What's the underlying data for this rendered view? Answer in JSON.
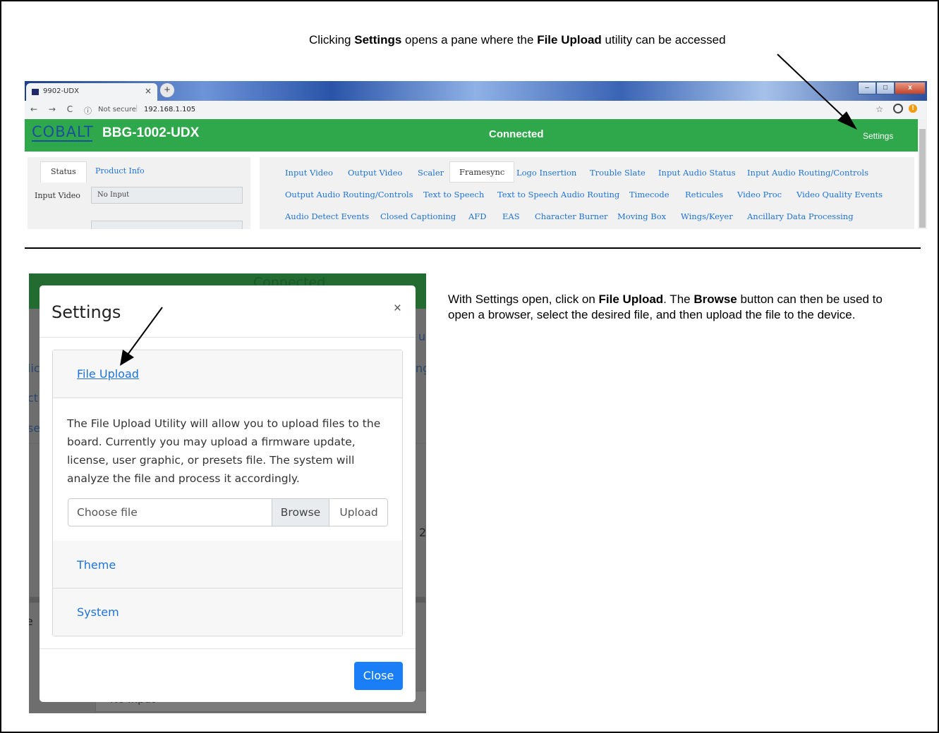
{
  "top_caption": {
    "pre": "Clicking ",
    "b1": "Settings",
    "mid": " opens a pane where the ",
    "b2": "File Upload",
    "post": " utility can be accessed"
  },
  "browser": {
    "tab_title": "9902-UDX",
    "tab_close": "×",
    "new_tab": "+",
    "window_buttons": [
      "–",
      "□",
      "x"
    ],
    "nav_buttons": "← → C",
    "info_icon": "ⓘ",
    "security": "Not secure",
    "separator": "|",
    "url": "192.168.1.105",
    "star_icon": "☆",
    "warn_icon": "!"
  },
  "app": {
    "logo": "COBALT",
    "device": "BBG-1002-UDX",
    "status": "Connected",
    "settings_link": "Settings",
    "left_tabs": [
      "Status",
      "Product Info"
    ],
    "input_video_label": "Input Video",
    "input_video_value": "No Input",
    "nav_row1": [
      "Input Video",
      "Output Video",
      "Scaler",
      "Framesync",
      "Logo Insertion",
      "Trouble Slate",
      "Input Audio Status",
      "Input Audio Routing/Controls"
    ],
    "nav_row2": [
      "Output Audio Routing/Controls",
      "Text to Speech",
      "Text to Speech Audio Routing",
      "Timecode",
      "Reticules",
      "Video Proc",
      "Video Quality Events"
    ],
    "nav_row3": [
      "Audio Detect Events",
      "Closed Captioning",
      "AFD",
      "EAS",
      "Character Burner",
      "Moving Box",
      "Wings/Keyer",
      "Ancillary Data Processing"
    ]
  },
  "modal": {
    "bg_connected": "Connected",
    "bg_fragments": [
      "ub",
      "lic",
      "ng",
      "ct",
      "se",
      "2",
      "e"
    ],
    "bg_input_value": "No Input",
    "title": "Settings",
    "close_x": "×",
    "sections": [
      "File Upload",
      "Theme",
      "System"
    ],
    "description": "The File Upload Utility will allow you to upload files to the board. Currently you may upload a firmware update, license, user graphic, or presets file. The system will analyze the file and process it accordingly.",
    "file_placeholder": "Choose file",
    "browse": "Browse",
    "upload": "Upload",
    "close_button": "Close"
  },
  "side_caption": {
    "pre": "With Settings open, click on ",
    "b1": "File Upload",
    "mid": ". The ",
    "b2": "Browse",
    "post": " button can then be used to open a browser, select the desired file, and then upload the file to the device."
  },
  "colors": {
    "app_green": "#2ea84a",
    "link_blue": "#1e73d8",
    "primary_button": "#1a7ef6"
  }
}
